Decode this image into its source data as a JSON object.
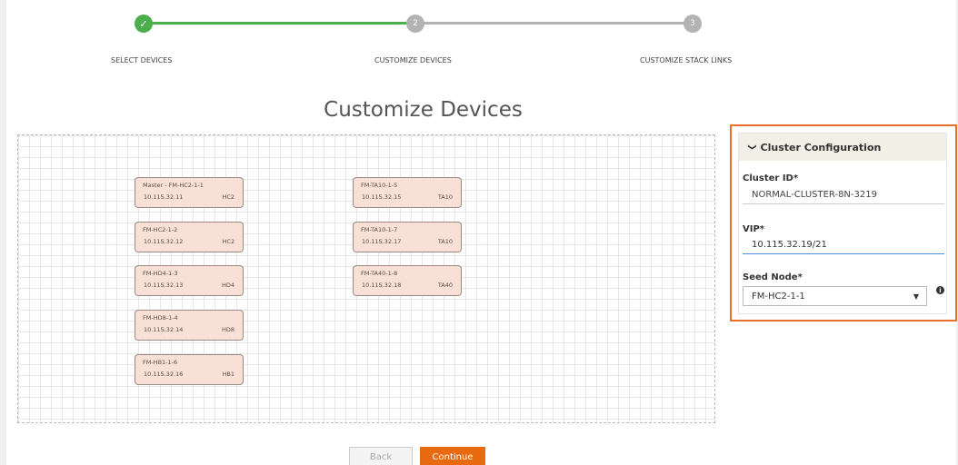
{
  "stepper": {
    "steps": [
      {
        "number": "✓",
        "label": "SELECT DEVICES",
        "state": "done"
      },
      {
        "number": "2",
        "label": "CUSTOMIZE DEVICES",
        "state": "todo"
      },
      {
        "number": "3",
        "label": "CUSTOMIZE STACK LINKS",
        "state": "todo"
      }
    ],
    "colors": {
      "done": "#4cae4c",
      "todo": "#b3b3b3"
    }
  },
  "page_title": "Customize Devices",
  "devices": [
    {
      "name": "Master - FM-HC2-1-1",
      "ip": "10.115.32.11",
      "model": "HC2"
    },
    {
      "name": "FM-HC2-1-2",
      "ip": "10.115.32.12",
      "model": "HC2"
    },
    {
      "name": "FM-HD4-1-3",
      "ip": "10.115.32.13",
      "model": "HD4"
    },
    {
      "name": "FM-HD8-1-4",
      "ip": "10.115.32.14",
      "model": "HD8"
    },
    {
      "name": "FM-HB1-1-6",
      "ip": "10.115.32.16",
      "model": "HB1"
    },
    {
      "name": "FM-TA10-1-5",
      "ip": "10.115.32.15",
      "model": "TA10"
    },
    {
      "name": "FM-TA10-1-7",
      "ip": "10.115.32.17",
      "model": "TA10"
    },
    {
      "name": "FM-TA40-1-8",
      "ip": "10.115.32.18",
      "model": "TA40"
    }
  ],
  "cluster_panel": {
    "title": "Cluster Configuration",
    "cluster_id_label": "Cluster ID*",
    "cluster_id_value": "NORMAL-CLUSTER-8N-3219",
    "vip_label": "VIP*",
    "vip_value": "10.115.32.19/21",
    "seed_node_label": "Seed Node*",
    "seed_node_value": "FM-HC2-1-1",
    "info_icon": "i",
    "highlight_color": "#e8702a"
  },
  "buttons": {
    "back": "Back",
    "continue": "Continue"
  }
}
